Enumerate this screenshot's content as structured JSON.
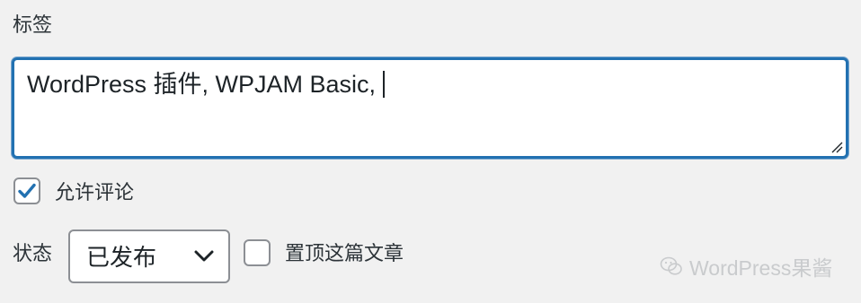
{
  "tags": {
    "label": "标签",
    "value": "WordPress 插件, WPJAM Basic,"
  },
  "allow_comments": {
    "label": "允许评论",
    "checked": true
  },
  "status": {
    "label": "状态",
    "selected": "已发布"
  },
  "sticky": {
    "label": "置顶这篇文章",
    "checked": false
  },
  "watermark": {
    "text": "WordPress果酱",
    "icon": "wechat-icon"
  },
  "colors": {
    "focus_border": "#2271b1",
    "checkmark": "#2271b1",
    "background": "#f1f1f1"
  }
}
